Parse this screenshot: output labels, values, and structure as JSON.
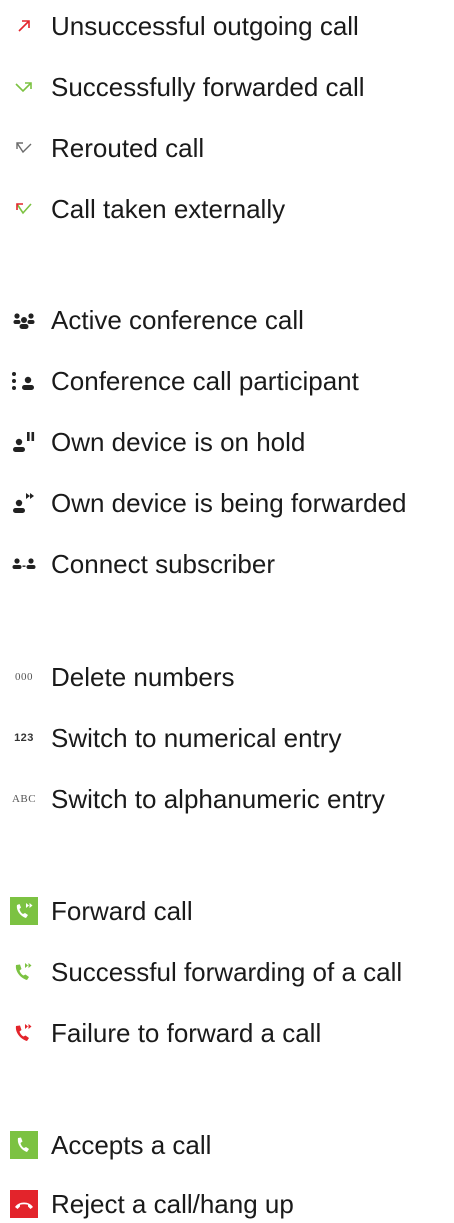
{
  "colors": {
    "red": "#e3242b",
    "green": "#7cc242",
    "gray": "#6b6b6b",
    "dark": "#222222"
  },
  "groups": [
    {
      "items": [
        {
          "icon": "unsuccessful-outgoing-arrow-icon",
          "label": "Unsuccessful outgoing call"
        },
        {
          "icon": "forwarded-call-arrow-icon",
          "label": "Successfully forwarded call"
        },
        {
          "icon": "rerouted-call-arrow-icon",
          "label": "Rerouted call"
        },
        {
          "icon": "taken-externally-arrow-icon",
          "label": "Call taken externally"
        }
      ]
    },
    {
      "items": [
        {
          "icon": "conference-group-icon",
          "label": "Active conference call"
        },
        {
          "icon": "conference-participant-icon",
          "label": "Conference call participant"
        },
        {
          "icon": "person-hold-icon",
          "label": "Own device is on hold"
        },
        {
          "icon": "person-forward-icon",
          "label": "Own device is being forwarded"
        },
        {
          "icon": "two-persons-connect-icon",
          "label": "Connect subscriber"
        }
      ]
    },
    {
      "items": [
        {
          "icon": "zeros-icon",
          "text": "000",
          "label": "Delete numbers"
        },
        {
          "icon": "numeric-icon",
          "text": "123",
          "label": "Switch to numerical entry"
        },
        {
          "icon": "alpha-icon",
          "text": "ABC",
          "label": "Switch to alphanumeric entry"
        }
      ]
    },
    {
      "items": [
        {
          "icon": "forward-call-button-icon",
          "label": "Forward call"
        },
        {
          "icon": "forward-success-icon",
          "label": "Successful forwarding of a call"
        },
        {
          "icon": "forward-failure-icon",
          "label": "Failure to forward a call"
        }
      ]
    },
    {
      "items": [
        {
          "icon": "accept-call-icon",
          "label": "Accepts a call"
        },
        {
          "icon": "reject-call-icon",
          "label": "Reject a call/hang up"
        }
      ]
    }
  ]
}
